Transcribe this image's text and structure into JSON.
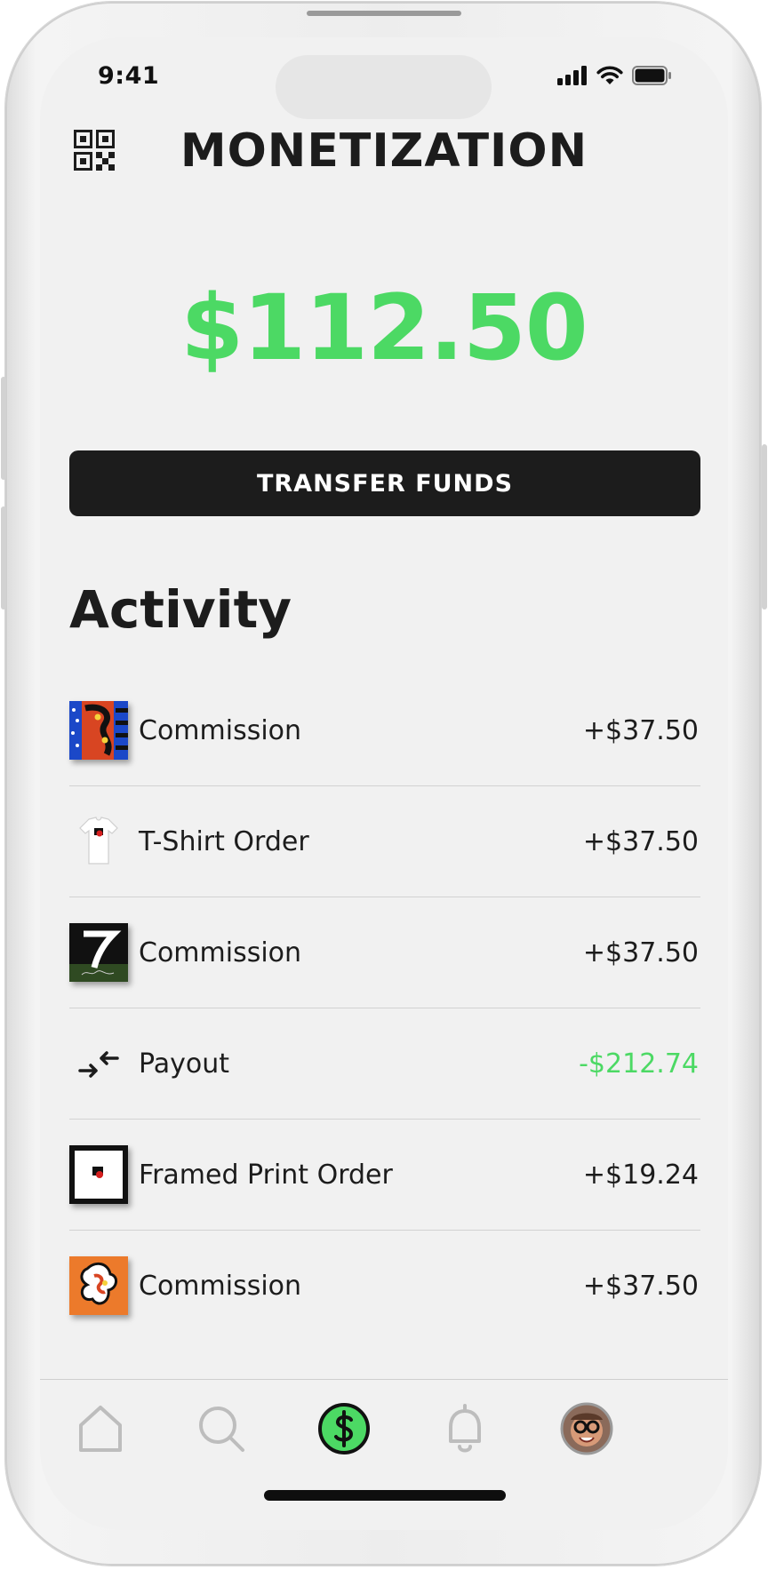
{
  "status_bar": {
    "time": "9:41"
  },
  "header": {
    "title": "MONETIZATION"
  },
  "balance": {
    "amount": "$112.50"
  },
  "transfer_button": {
    "label": "TRANSFER FUNDS"
  },
  "activity": {
    "title": "Activity",
    "items": [
      {
        "label": "Commission",
        "amount": "+$37.50",
        "icon": "artwork-thumbnail-icon"
      },
      {
        "label": "T-Shirt Order",
        "amount": "+$37.50",
        "icon": "tshirt-icon"
      },
      {
        "label": "Commission",
        "amount": "+$37.50",
        "icon": "artwork-thumbnail-icon"
      },
      {
        "label": "Payout",
        "amount": "-$212.74",
        "icon": "payout-arrows-icon"
      },
      {
        "label": "Framed Print Order",
        "amount": "+$19.24",
        "icon": "framed-print-icon"
      },
      {
        "label": "Commission",
        "amount": "+$37.50",
        "icon": "artwork-thumbnail-icon"
      }
    ]
  },
  "tab_bar": {
    "items": [
      {
        "icon": "home-icon"
      },
      {
        "icon": "search-icon"
      },
      {
        "icon": "dollar-icon",
        "active": true
      },
      {
        "icon": "bell-icon"
      },
      {
        "icon": "avatar"
      }
    ]
  },
  "colors": {
    "accent": "#4cd964",
    "dark": "#1c1c1c",
    "background": "#f1f1f1"
  }
}
